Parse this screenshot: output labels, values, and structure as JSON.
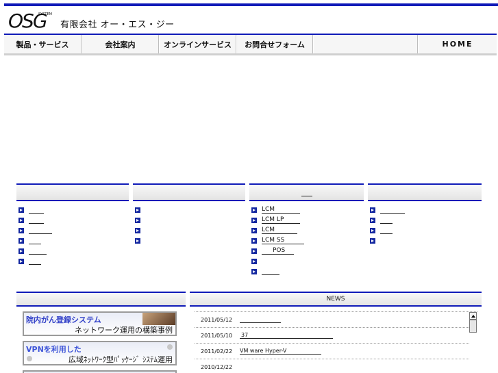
{
  "header": {
    "logo_text": "OSG",
    "logo_sub": "SYSTEM",
    "company_name": "有限会社 オー・エス・ジー"
  },
  "nav": {
    "items": [
      {
        "label": "製品・サービス"
      },
      {
        "label": "会社案内"
      },
      {
        "label": "オンラインサービス"
      },
      {
        "label": "お問合せフォーム"
      },
      {
        "label": ""
      },
      {
        "label": "HOME"
      }
    ]
  },
  "columns": [
    {
      "title": "",
      "items": [
        "",
        "",
        "",
        "",
        "",
        ""
      ]
    },
    {
      "title": "",
      "items": [
        "",
        "",
        "",
        ""
      ]
    },
    {
      "title": "",
      "items": [
        "LCM",
        "LCM LP",
        "LCM",
        "LCM SS",
        "POS",
        "",
        ""
      ]
    },
    {
      "title": "",
      "items": [
        "",
        "",
        "",
        ""
      ]
    }
  ],
  "banners": [
    {
      "title": "院内がん登録システム",
      "subtitle": "ネットワーク運用の構築事例"
    },
    {
      "title": "VPNを利用した",
      "subtitle": "広域ﾈｯﾄﾜｰｸ型ﾊﾟｯｹｰｼﾞ ｼｽﾃﾑ運用"
    }
  ],
  "news": {
    "title": "NEWS",
    "items": [
      {
        "date": "2011/05/12",
        "text": ""
      },
      {
        "date": "2011/05/10",
        "text": "37"
      },
      {
        "date": "2011/02/22",
        "text": "VM ware Hyper-V"
      },
      {
        "date": "2010/12/22",
        "text": ""
      }
    ]
  },
  "colors": {
    "accent": "#0f1ab8",
    "bullet": "#1428a0"
  }
}
